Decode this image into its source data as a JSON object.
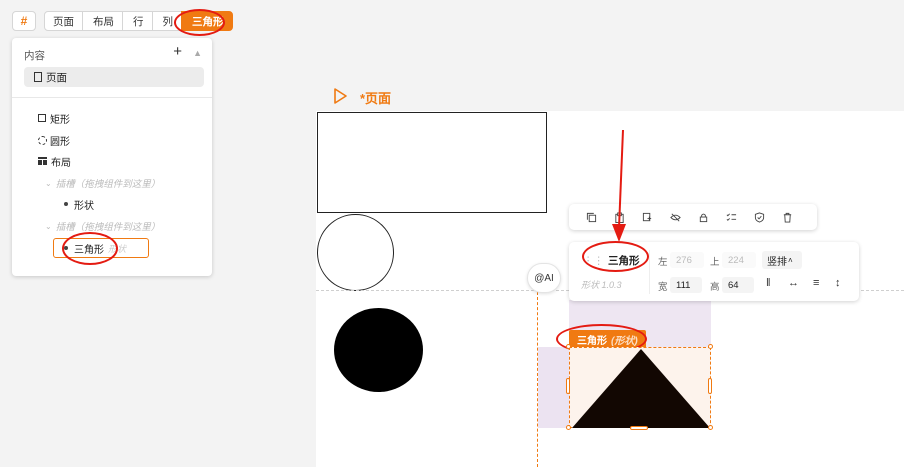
{
  "breadcrumb": {
    "hash": "#",
    "items": [
      "页面",
      "布局",
      "行",
      "列"
    ],
    "active": "三角形"
  },
  "panel": {
    "title": "内容",
    "add": "+",
    "page_item": "页面",
    "tree": {
      "rect": "矩形",
      "circle": "圆形",
      "layout": "布局",
      "slot1": "插槽（拖拽组件到这里）",
      "shape": "形状",
      "slot2": "插槽（拖拽组件到这里）",
      "selected": "三角形",
      "selected_ghost": "形状"
    }
  },
  "canvas": {
    "page_title": "*页面",
    "ai_button": "@AI"
  },
  "toolbar": {
    "icons": [
      "copy-icon",
      "paste-icon",
      "duplicate-icon",
      "hide-icon",
      "lock-icon",
      "checklist-icon",
      "shield-check-icon",
      "delete-icon"
    ]
  },
  "props": {
    "name": "三角形",
    "version": "形状 1.0.3",
    "left_label": "左",
    "left_value": "276",
    "top_label": "上",
    "top_value": "224",
    "direction": "竖排",
    "width_label": "宽",
    "width_value": "111",
    "height_label": "高",
    "height_value": "64"
  },
  "selection": {
    "label": "三角形",
    "ghost": "(形状)"
  },
  "colors": {
    "accent": "#f07a12",
    "annotation": "#e41b12"
  }
}
